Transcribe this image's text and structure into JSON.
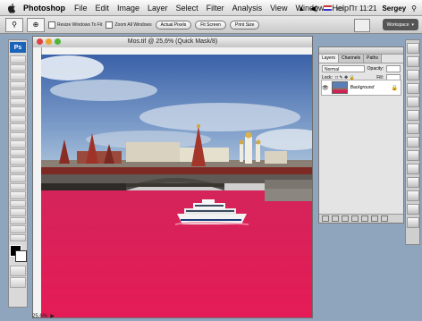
{
  "menubar": {
    "app_name": "Photoshop",
    "items": [
      "File",
      "Edit",
      "Image",
      "Layer",
      "Select",
      "Filter",
      "Analysis",
      "View",
      "Window",
      "Help"
    ],
    "clock": "Пт 11:21",
    "user": "Sergey"
  },
  "options": {
    "checkbox_1": "Resize Windows To Fit",
    "checkbox_2": "Zoom All Windows",
    "btn_actual": "Actual Pixels",
    "btn_fit": "Fit Screen",
    "btn_print": "Print Size",
    "workspace": "Workspace"
  },
  "toolbox": {
    "badge": "Ps"
  },
  "document": {
    "title": "Mos.tif @ 25,6% (Quick Mask/8)"
  },
  "layers_panel": {
    "tabs": [
      "Layers",
      "Channels",
      "Paths"
    ],
    "blend_label": "Normal",
    "opacity_label": "Opacity:",
    "lock_label": "Lock:",
    "fill_label": "Fill:",
    "layer_name": "Background"
  },
  "colors": {
    "mask_red": "#d71c58",
    "sky_top": "#3a61a8",
    "sky_bottom": "#a8c2dc"
  }
}
